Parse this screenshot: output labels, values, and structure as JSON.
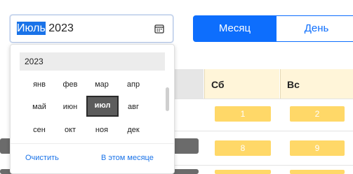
{
  "header": {
    "month_selected": "Июль",
    "year": "2023",
    "view_month_label": "Месяц",
    "view_day_label": "День"
  },
  "picker": {
    "year_label": "2023",
    "months": [
      {
        "label": "янв",
        "active": false
      },
      {
        "label": "фев",
        "active": false
      },
      {
        "label": "мар",
        "active": false
      },
      {
        "label": "апр",
        "active": false
      },
      {
        "label": "май",
        "active": false
      },
      {
        "label": "июн",
        "active": false
      },
      {
        "label": "июл",
        "active": true
      },
      {
        "label": "авг",
        "active": false
      },
      {
        "label": "сен",
        "active": false
      },
      {
        "label": "окт",
        "active": false
      },
      {
        "label": "ноя",
        "active": false
      },
      {
        "label": "дек",
        "active": false
      }
    ],
    "clear_label": "Очистить",
    "this_month_label": "В этом месяце"
  },
  "calendar": {
    "columns": [
      "Сб",
      "Вс"
    ],
    "days": {
      "sat_1": "1",
      "sun_1": "2",
      "sat_2": "8",
      "sun_2": "9"
    }
  },
  "colors": {
    "accent": "#0d6efd",
    "weekend_cell": "#ffd868",
    "active_month": "#5c5c5c"
  }
}
